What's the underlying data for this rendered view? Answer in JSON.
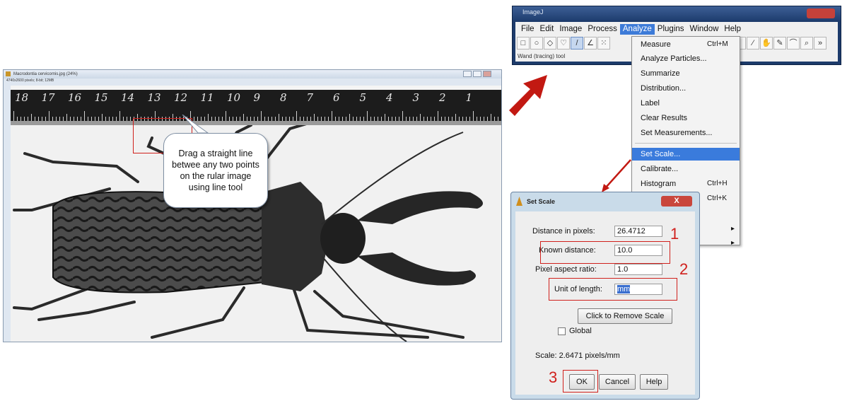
{
  "image_window": {
    "title": "Macrodontia cervicornis.jpg (24%)",
    "info": "4740x2600 pixels; 8-bit; 12MB",
    "ruler_numbers": [
      "18",
      "17",
      "16",
      "15",
      "14",
      "13",
      "12",
      "11",
      "10",
      "9",
      "8",
      "7",
      "6",
      "5",
      "4",
      "3",
      "2",
      "1"
    ],
    "callout_text": "Drag a straight line\nbetwee any two points\non the rular image\nusing line tool"
  },
  "imagej_window": {
    "title": "ImageJ",
    "menus": [
      "File",
      "Edit",
      "Image",
      "Process",
      "Analyze",
      "Plugins",
      "Window",
      "Help"
    ],
    "active_menu": "Analyze",
    "status": "Wand (tracing) tool"
  },
  "analyze_menu": {
    "items": [
      {
        "label": "Measure",
        "shortcut": "Ctrl+M"
      },
      {
        "label": "Analyze Particles...",
        "shortcut": ""
      },
      {
        "label": "Summarize",
        "shortcut": ""
      },
      {
        "label": "Distribution...",
        "shortcut": ""
      },
      {
        "label": "Label",
        "shortcut": ""
      },
      {
        "label": "Clear Results",
        "shortcut": ""
      },
      {
        "label": "Set Measurements...",
        "shortcut": ""
      },
      {
        "label": "Set Scale...",
        "shortcut": ""
      },
      {
        "label": "Calibrate...",
        "shortcut": ""
      },
      {
        "label": "Histogram",
        "shortcut": "Ctrl+H"
      },
      {
        "label": "",
        "shortcut": "Ctrl+K"
      }
    ],
    "highlighted": "Set Scale..."
  },
  "set_scale_dialog": {
    "title": "Set Scale",
    "close_label": "X",
    "distance_label": "Distance in pixels:",
    "distance_value": "26.4712",
    "known_label": "Known distance:",
    "known_value": "10.0",
    "aspect_label": "Pixel aspect ratio:",
    "aspect_value": "1.0",
    "unit_label": "Unit of length:",
    "unit_value": "mm",
    "remove_scale_label": "Click to Remove Scale",
    "global_label": "Global",
    "global_checked": false,
    "scale_text": "Scale: 2.6471 pixels/mm",
    "ok_label": "OK",
    "cancel_label": "Cancel",
    "help_label": "Help"
  },
  "steps": [
    "1",
    "2",
    "3"
  ],
  "colors": {
    "annotation_red": "#d0201c",
    "menu_highlight": "#3a7bdc",
    "titlebar_blue": "#1f3e70"
  }
}
